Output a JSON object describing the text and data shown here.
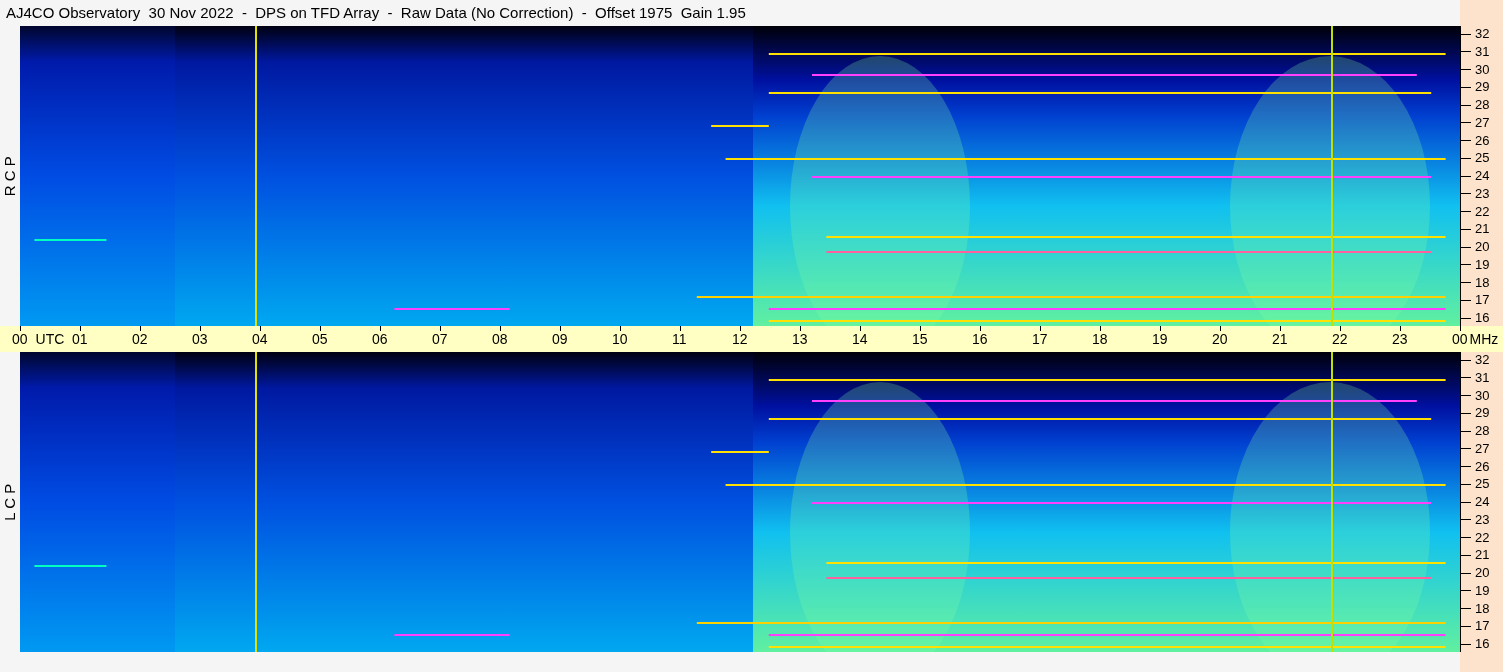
{
  "title": "AJ4CO Observatory  30 Nov 2022  -  DPS on TFD Array  -  Raw Data (No Correction)  -  Offset 1975  Gain 1.95",
  "panels": [
    {
      "label": "R C P",
      "frequency_ticks": [
        "32",
        "31",
        "30",
        "29",
        "28",
        "27",
        "26",
        "25",
        "24",
        "23",
        "22",
        "21",
        "20",
        "19",
        "18",
        "17",
        "16"
      ]
    },
    {
      "label": "L C P",
      "frequency_ticks": [
        "32",
        "31",
        "30",
        "29",
        "28",
        "27",
        "26",
        "25",
        "24",
        "23",
        "22",
        "21",
        "20",
        "19",
        "18",
        "17",
        "16"
      ]
    }
  ],
  "time_axis": {
    "labels": [
      "00",
      "01",
      "02",
      "03",
      "04",
      "05",
      "06",
      "07",
      "08",
      "09",
      "10",
      "11",
      "12",
      "13",
      "14",
      "15",
      "16",
      "17",
      "18",
      "19",
      "20",
      "21",
      "22",
      "23",
      "00"
    ],
    "timezone": "UTC",
    "unit": "MHz"
  }
}
